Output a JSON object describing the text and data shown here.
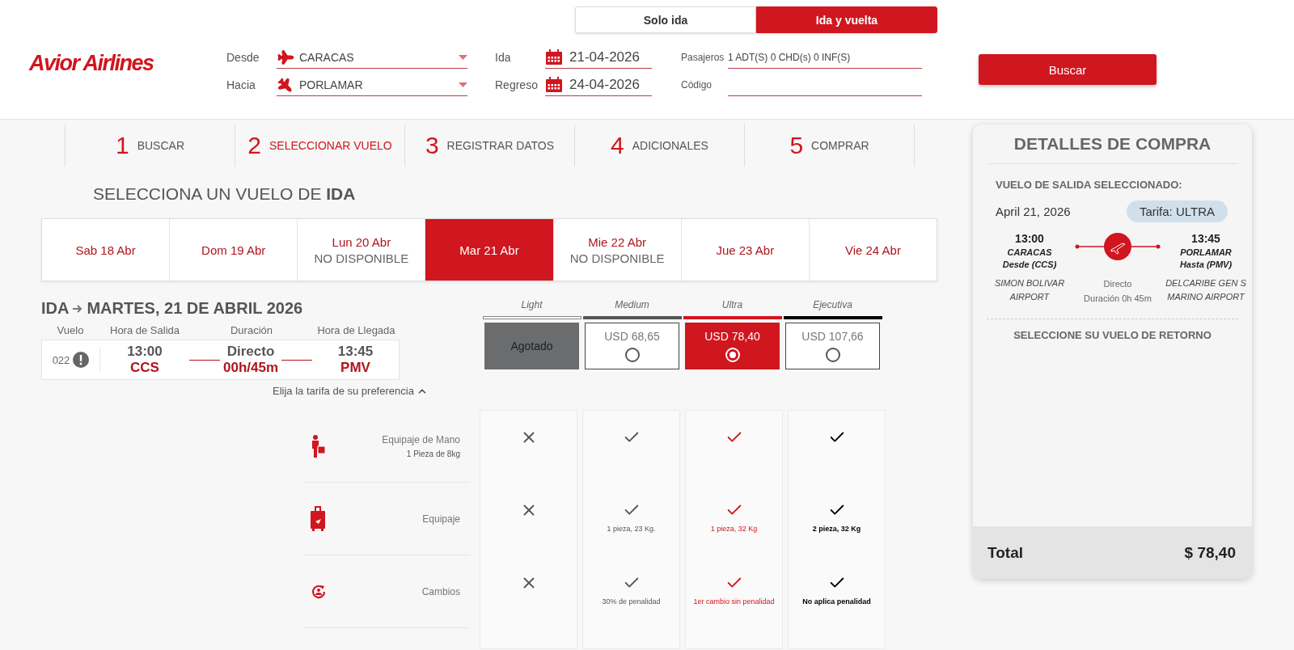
{
  "header": {
    "logo": "Avior Airlines",
    "trip_types": [
      {
        "label": "Solo ida",
        "selected": false
      },
      {
        "label": "Ida y vuelta",
        "selected": true
      }
    ],
    "from": {
      "label": "Desde",
      "value": "CARACAS"
    },
    "to": {
      "label": "Hacia",
      "value": "PORLAMAR"
    },
    "departure_date": {
      "label": "Ida",
      "value": "21-04-2026"
    },
    "return_date": {
      "label": "Regreso",
      "value": "24-04-2026"
    },
    "passengers": {
      "label": "Pasajeros",
      "value": "1 ADT(S) 0 CHD(s) 0 INF(S)"
    },
    "code": {
      "label": "Código"
    },
    "search_button": "Buscar"
  },
  "steps": [
    {
      "number": "1",
      "label": "BUSCAR",
      "selected": false
    },
    {
      "number": "2",
      "label": "SELECCIONAR VUELO",
      "selected": true
    },
    {
      "number": "3",
      "label": "REGISTRAR DATOS",
      "selected": false
    },
    {
      "number": "4",
      "label": "ADICIONALES",
      "selected": false
    },
    {
      "number": "5",
      "label": "COMPRAR",
      "selected": false
    }
  ],
  "heading": "SELECCIONA UN VUELO DE **IDA**",
  "dates": [
    {
      "label": "Sab 18 Abr",
      "selected": false
    },
    {
      "label": "Dom 19 Abr",
      "selected": false
    },
    {
      "label": "Lun 20 Abr",
      "status": "NO DISPONIBLE",
      "selected": false
    },
    {
      "label": "Mar 21 Abr",
      "selected": true
    },
    {
      "label": "Mie 22 Abr",
      "status": "NO DISPONIBLE",
      "selected": false
    },
    {
      "label": "Jue 23 Abr",
      "selected": false
    },
    {
      "label": "Vie 24 Abr",
      "selected": false
    }
  ],
  "flight": {
    "direction": "IDA",
    "date": "MARTES, 21 DE ABRIL 2026",
    "columns": [
      "Vuelo",
      "Hora de Salida",
      "Duración",
      "Hora de Llegada"
    ],
    "number": "022",
    "departure": {
      "time": "13:00",
      "code": "CCS"
    },
    "duration": {
      "type": "Directo",
      "value": "00h/45m"
    },
    "arrival": {
      "time": "13:45",
      "code": "PMV"
    }
  },
  "fares": [
    {
      "name": "Light",
      "kind": "sold_out",
      "text": "Agotado",
      "color": "#ffffff",
      "selected": false
    },
    {
      "name": "Medium",
      "kind": "price",
      "text": "USD 68,65",
      "color": "#555555",
      "selected": false
    },
    {
      "name": "Ultra",
      "kind": "price",
      "text": "USD 78,40",
      "color": "#d0161e",
      "selected": true
    },
    {
      "name": "Ejecutiva",
      "kind": "price",
      "text": "USD 107,66",
      "color": "#000000",
      "selected": false
    }
  ],
  "fare_hint": {
    "label": "Elija la tarifa de su preferencia",
    "expanded": true
  },
  "features": [
    {
      "kind": "hand_luggage",
      "label": "Equipaje de Mano",
      "sublabel": "1 Pieza de 8kg",
      "cells": [
        {
          "included": false
        },
        {
          "included": true
        },
        {
          "included": true
        },
        {
          "included": true
        }
      ]
    },
    {
      "kind": "luggage",
      "label": "Equipaje",
      "cells": [
        {
          "included": false
        },
        {
          "included": true,
          "note": "1 pieza, 23 Kg."
        },
        {
          "included": true,
          "note": "1 pieza, 32 Kg"
        },
        {
          "included": true,
          "note": "2 pieza, 32 Kg"
        }
      ]
    },
    {
      "kind": "changes",
      "label": "Cambios",
      "cells": [
        {
          "included": false
        },
        {
          "included": true,
          "note": "30% de penalidad"
        },
        {
          "included": true,
          "note": "1er cambio sin penalidad"
        },
        {
          "included": true,
          "note": "No aplica penalidad"
        }
      ]
    }
  ],
  "summary": {
    "title": "DETALLES DE COMPRA",
    "section": "VUELO DE SALIDA SELECCIONADO:",
    "date": "April 21, 2026",
    "tariff": "Tarifa: ULTRA",
    "departure": {
      "time": "13:00",
      "city": "CARACAS",
      "code": "Desde (CCS)",
      "airport": "SIMON BOLIVAR AIRPORT"
    },
    "route": {
      "type": "Directo",
      "duration": "Duración 0h 45m"
    },
    "arrival": {
      "time": "13:45",
      "city": "PORLAMAR",
      "code": "Hasta (PMV)",
      "airport": "DELCARIBE GEN S MARINO AIRPORT"
    },
    "return_label": "SELECCIONE SU VUELO DE RETORNO",
    "total": {
      "label": "Total",
      "value": "$ 78,40"
    }
  }
}
